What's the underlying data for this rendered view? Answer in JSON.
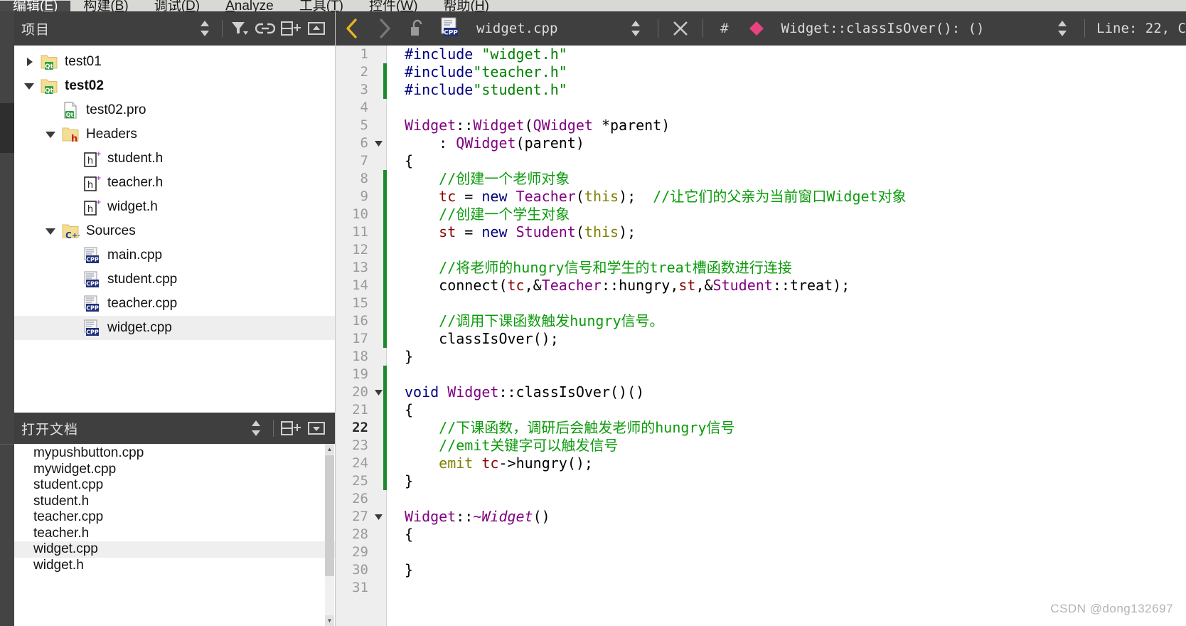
{
  "menubar": {
    "items": [
      {
        "label": "编辑(E)",
        "mnemonic": "E",
        "selected": true
      },
      {
        "label": "构建(B)",
        "mnemonic": "B",
        "selected": false
      },
      {
        "label": "调试(D)",
        "mnemonic": "D",
        "selected": false
      },
      {
        "label": "Analyze",
        "mnemonic": "A",
        "selected": false
      },
      {
        "label": "工具(T)",
        "mnemonic": "T",
        "selected": false
      },
      {
        "label": "控件(W)",
        "mnemonic": "W",
        "selected": false
      },
      {
        "label": "帮助(H)",
        "mnemonic": "H",
        "selected": false
      }
    ]
  },
  "project_panel": {
    "title": "项目",
    "icons": [
      "sort-updown-icon",
      "filter-icon",
      "link-icon",
      "split-add-icon",
      "minimize-icon"
    ],
    "tree": [
      {
        "label": "test01",
        "indent": 1,
        "twisty": "collapsed",
        "icon": "qt-folder-icon",
        "bold": false,
        "selected": false
      },
      {
        "label": "test02",
        "indent": 1,
        "twisty": "expanded",
        "icon": "qt-folder-icon",
        "bold": true,
        "selected": false
      },
      {
        "label": "test02.pro",
        "indent": 2,
        "twisty": "none",
        "icon": "qt-pro-file-icon",
        "bold": false,
        "selected": false
      },
      {
        "label": "Headers",
        "indent": 2,
        "twisty": "expanded",
        "icon": "h-folder-icon",
        "bold": false,
        "selected": false
      },
      {
        "label": "student.h",
        "indent": 3,
        "twisty": "none",
        "icon": "hpp-file-icon",
        "bold": false,
        "selected": false
      },
      {
        "label": "teacher.h",
        "indent": 3,
        "twisty": "none",
        "icon": "hpp-file-icon",
        "bold": false,
        "selected": false
      },
      {
        "label": "widget.h",
        "indent": 3,
        "twisty": "none",
        "icon": "hpp-file-icon",
        "bold": false,
        "selected": false
      },
      {
        "label": "Sources",
        "indent": 2,
        "twisty": "expanded",
        "icon": "cpp-folder-icon",
        "bold": false,
        "selected": false
      },
      {
        "label": "main.cpp",
        "indent": 3,
        "twisty": "none",
        "icon": "cpp-file-icon",
        "bold": false,
        "selected": false
      },
      {
        "label": "student.cpp",
        "indent": 3,
        "twisty": "none",
        "icon": "cpp-file-icon",
        "bold": false,
        "selected": false
      },
      {
        "label": "teacher.cpp",
        "indent": 3,
        "twisty": "none",
        "icon": "cpp-file-icon",
        "bold": false,
        "selected": false
      },
      {
        "label": "widget.cpp",
        "indent": 3,
        "twisty": "none",
        "icon": "cpp-file-icon",
        "bold": false,
        "selected": true
      }
    ]
  },
  "open_documents": {
    "title": "打开文档",
    "icons": [
      "sort-updown-icon",
      "split-add-icon",
      "minimize-icon"
    ],
    "items": [
      {
        "label": "mypushbutton.cpp",
        "selected": false
      },
      {
        "label": "mywidget.cpp",
        "selected": false
      },
      {
        "label": "student.cpp",
        "selected": false
      },
      {
        "label": "student.h",
        "selected": false
      },
      {
        "label": "teacher.cpp",
        "selected": false
      },
      {
        "label": "teacher.h",
        "selected": false
      },
      {
        "label": "widget.cpp",
        "selected": true
      },
      {
        "label": "widget.h",
        "selected": false
      }
    ]
  },
  "editor_toolbar": {
    "back_icon": "chevron-left-icon",
    "forward_icon": "chevron-right-icon",
    "lock_icon": "unlocked-icon",
    "file_icon": "cpp-file-icon",
    "filename": "widget.cpp",
    "updown_icon": "sort-updown-icon",
    "close_icon": "close-icon",
    "hash_label": "#",
    "symbol_icon": "method-diamond-icon",
    "symbol": "Widget::classIsOver(): ()",
    "symbol_updown_icon": "sort-updown-icon",
    "line_status": "Line: 22, C"
  },
  "editor": {
    "current_line": 22,
    "colors": {
      "preprocessor": "#000080",
      "string": "#008000",
      "comment": "#0d9b0d",
      "type": "#800080",
      "keyword": "#000080",
      "this_keyword": "#808000",
      "variable": "#8b0000",
      "plain": "#000000",
      "change_bar": "#1e8a2e"
    },
    "lines": [
      {
        "n": 1,
        "fold": "",
        "changed": false,
        "indent": 0,
        "tokens": [
          {
            "t": "#include ",
            "c": "s-pre"
          },
          {
            "t": "\"widget.h\"",
            "c": "s-str"
          }
        ]
      },
      {
        "n": 2,
        "fold": "",
        "changed": true,
        "indent": 0,
        "tokens": [
          {
            "t": "#include",
            "c": "s-pre"
          },
          {
            "t": "\"teacher.h\"",
            "c": "s-str"
          }
        ]
      },
      {
        "n": 3,
        "fold": "",
        "changed": true,
        "indent": 0,
        "tokens": [
          {
            "t": "#include",
            "c": "s-pre"
          },
          {
            "t": "\"student.h\"",
            "c": "s-str"
          }
        ]
      },
      {
        "n": 4,
        "fold": "",
        "changed": false,
        "indent": 0,
        "tokens": []
      },
      {
        "n": 5,
        "fold": "",
        "changed": false,
        "indent": 0,
        "tokens": [
          {
            "t": "Widget",
            "c": "s-type"
          },
          {
            "t": "::",
            "c": "s-plain"
          },
          {
            "t": "Widget",
            "c": "s-type"
          },
          {
            "t": "(",
            "c": "s-plain"
          },
          {
            "t": "QWidget",
            "c": "s-type"
          },
          {
            "t": " *parent)",
            "c": "s-plain"
          }
        ]
      },
      {
        "n": 6,
        "fold": "down",
        "changed": false,
        "indent": 0,
        "tokens": [
          {
            "t": "    : ",
            "c": "s-plain"
          },
          {
            "t": "QWidget",
            "c": "s-type"
          },
          {
            "t": "(parent)",
            "c": "s-plain"
          }
        ]
      },
      {
        "n": 7,
        "fold": "",
        "changed": false,
        "indent": 0,
        "tokens": [
          {
            "t": "{",
            "c": "s-plain"
          }
        ]
      },
      {
        "n": 8,
        "fold": "",
        "changed": true,
        "indent": 0,
        "tokens": [
          {
            "t": "    //创建一个老师对象",
            "c": "s-cmt"
          }
        ]
      },
      {
        "n": 9,
        "fold": "",
        "changed": true,
        "indent": 0,
        "tokens": [
          {
            "t": "    ",
            "c": "s-plain"
          },
          {
            "t": "tc",
            "c": "s-var"
          },
          {
            "t": " = ",
            "c": "s-plain"
          },
          {
            "t": "new",
            "c": "s-kw"
          },
          {
            "t": " ",
            "c": "s-plain"
          },
          {
            "t": "Teacher",
            "c": "s-type"
          },
          {
            "t": "(",
            "c": "s-plain"
          },
          {
            "t": "this",
            "c": "s-this"
          },
          {
            "t": ");  ",
            "c": "s-plain"
          },
          {
            "t": "//让它们的父亲为当前窗口Widget对象",
            "c": "s-cmt"
          }
        ]
      },
      {
        "n": 10,
        "fold": "",
        "changed": true,
        "indent": 0,
        "tokens": [
          {
            "t": "    //创建一个学生对象",
            "c": "s-cmt"
          }
        ]
      },
      {
        "n": 11,
        "fold": "",
        "changed": true,
        "indent": 0,
        "tokens": [
          {
            "t": "    ",
            "c": "s-plain"
          },
          {
            "t": "st",
            "c": "s-var"
          },
          {
            "t": " = ",
            "c": "s-plain"
          },
          {
            "t": "new",
            "c": "s-kw"
          },
          {
            "t": " ",
            "c": "s-plain"
          },
          {
            "t": "Student",
            "c": "s-type"
          },
          {
            "t": "(",
            "c": "s-plain"
          },
          {
            "t": "this",
            "c": "s-this"
          },
          {
            "t": ");",
            "c": "s-plain"
          }
        ]
      },
      {
        "n": 12,
        "fold": "",
        "changed": true,
        "indent": 0,
        "tokens": []
      },
      {
        "n": 13,
        "fold": "",
        "changed": true,
        "indent": 0,
        "tokens": [
          {
            "t": "    //将老师的hungry信号和学生的treat槽函数进行连接",
            "c": "s-cmt"
          }
        ]
      },
      {
        "n": 14,
        "fold": "",
        "changed": true,
        "indent": 0,
        "tokens": [
          {
            "t": "    connect(",
            "c": "s-plain"
          },
          {
            "t": "tc",
            "c": "s-var"
          },
          {
            "t": ",&",
            "c": "s-plain"
          },
          {
            "t": "Teacher",
            "c": "s-type"
          },
          {
            "t": "::hungry,",
            "c": "s-plain"
          },
          {
            "t": "st",
            "c": "s-var"
          },
          {
            "t": ",&",
            "c": "s-plain"
          },
          {
            "t": "Student",
            "c": "s-type"
          },
          {
            "t": "::treat);",
            "c": "s-plain"
          }
        ]
      },
      {
        "n": 15,
        "fold": "",
        "changed": true,
        "indent": 0,
        "tokens": []
      },
      {
        "n": 16,
        "fold": "",
        "changed": true,
        "indent": 0,
        "tokens": [
          {
            "t": "    //调用下课函数触发hungry信号。",
            "c": "s-cmt"
          }
        ]
      },
      {
        "n": 17,
        "fold": "",
        "changed": true,
        "indent": 0,
        "tokens": [
          {
            "t": "    classIsOver();",
            "c": "s-plain"
          }
        ]
      },
      {
        "n": 18,
        "fold": "",
        "changed": false,
        "indent": 0,
        "tokens": [
          {
            "t": "}",
            "c": "s-plain"
          }
        ]
      },
      {
        "n": 19,
        "fold": "",
        "changed": true,
        "indent": 0,
        "tokens": []
      },
      {
        "n": 20,
        "fold": "down",
        "changed": true,
        "indent": 0,
        "tokens": [
          {
            "t": "void",
            "c": "s-kw"
          },
          {
            "t": " ",
            "c": "s-plain"
          },
          {
            "t": "Widget",
            "c": "s-type"
          },
          {
            "t": "::classIsOver()()",
            "c": "s-plain"
          }
        ]
      },
      {
        "n": 21,
        "fold": "",
        "changed": true,
        "indent": 0,
        "tokens": [
          {
            "t": "{",
            "c": "s-plain"
          }
        ]
      },
      {
        "n": 22,
        "fold": "",
        "changed": true,
        "indent": 0,
        "current": true,
        "tokens": [
          {
            "t": "    //下课函数，调研后会触发老师的hungry信号",
            "c": "s-cmt"
          }
        ]
      },
      {
        "n": 23,
        "fold": "",
        "changed": true,
        "indent": 0,
        "tokens": [
          {
            "t": "    //emit关键字可以触发信号",
            "c": "s-cmt"
          }
        ]
      },
      {
        "n": 24,
        "fold": "",
        "changed": true,
        "indent": 0,
        "tokens": [
          {
            "t": "    ",
            "c": "s-plain"
          },
          {
            "t": "emit",
            "c": "s-this"
          },
          {
            "t": " ",
            "c": "s-plain"
          },
          {
            "t": "tc",
            "c": "s-var"
          },
          {
            "t": "->hungry();",
            "c": "s-plain"
          }
        ]
      },
      {
        "n": 25,
        "fold": "",
        "changed": true,
        "indent": 0,
        "tokens": [
          {
            "t": "}",
            "c": "s-plain"
          }
        ]
      },
      {
        "n": 26,
        "fold": "",
        "changed": false,
        "indent": 0,
        "tokens": []
      },
      {
        "n": 27,
        "fold": "down",
        "changed": false,
        "indent": 0,
        "tokens": [
          {
            "t": "Widget",
            "c": "s-type"
          },
          {
            "t": "::",
            "c": "s-plain"
          },
          {
            "t": "~Widget",
            "c": "s-type ital"
          },
          {
            "t": "()",
            "c": "s-plain"
          }
        ]
      },
      {
        "n": 28,
        "fold": "",
        "changed": false,
        "indent": 0,
        "tokens": [
          {
            "t": "{",
            "c": "s-plain"
          }
        ]
      },
      {
        "n": 29,
        "fold": "",
        "changed": false,
        "indent": 0,
        "tokens": []
      },
      {
        "n": 30,
        "fold": "",
        "changed": false,
        "indent": 0,
        "tokens": [
          {
            "t": "}",
            "c": "s-plain"
          }
        ]
      },
      {
        "n": 31,
        "fold": "",
        "changed": false,
        "indent": 0,
        "tokens": []
      }
    ]
  },
  "watermark": "CSDN @dong132697"
}
